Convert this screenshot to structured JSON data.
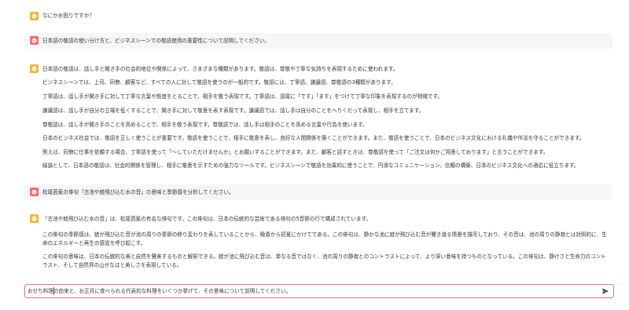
{
  "colors": {
    "assistant_avatar": "#f5b335",
    "user_avatar": "#f06a70",
    "user_bubble_bg": "#f6f6f8",
    "input_border": "#e06f86"
  },
  "icons": {
    "assistant_avatar": "robot-face-icon",
    "user_avatar": "person-face-icon",
    "send": "paper-plane-icon"
  },
  "messages": [
    {
      "role": "assistant",
      "lines": [
        "なにかお困りですか？"
      ]
    },
    {
      "role": "user",
      "lines": [
        "日本語の敬語の使い分け方と、ビジネスシーンでの敬語使用の重要性について説明してください。"
      ]
    },
    {
      "role": "assistant",
      "lines": [
        "日本語の敬語は、話し手と聞き手の社会的地位や関係によって、さまざまな種類があります。敬語は、尊敬や丁寧な気持ちを表現するために使われます。",
        "ビジネスシーンでは、上司、同僚、顧客など、すべての人に対して敬語を使うのが一般的です。敬語には、丁寧語、謙譲語、尊敬語の3種類があります。",
        "丁寧語は、話し手が聞き手に対して丁寧な言葉や態度をとることで、相手を敬う表現です。丁寧語は、語尾に「です」「ます」をつけて丁寧な印象を表現するのが特徴です。",
        "謙譲語は、話し手が自分の立場を低くすることで、聞き手に対して敬意を表す表現です。謙譲語では、話し手は自分のことをへりくだって表現し、相手を立てます。",
        "尊敬語は、話し手が聞き手のことを高めることで、相手を敬う表現です。尊敬語では、話し手は相手のことを高める言葉や行為を使います。",
        "日本のビジネス社会では、敬語を正しく使うことが重要です。敬語を使うことで、相手に敬意を表し、良好な人間関係を築くことができます。また、敬語を使うことで、日本のビジネス文化における礼儀や作法を守ることができます。",
        "例えば、同僚に仕事を依頼する場合、丁寧語を使って「〜していただけませんか」とお願いすることができます。また、顧客と話すときは、尊敬語を使って「ご注文は何かご用意しております」と言うことができます。",
        "結論として、日本語の敬語は、社会的関係を管理し、相手に敬意を示すための強力なツールです。ビジネスシーンで敬語を効果的に使うことで、円滑なコミュニケーション、信頼の構築、日本のビジネス文化への適応に役立ちます。"
      ]
    },
    {
      "role": "user",
      "lines": [
        "松尾芭蕉の俳句『古池や蛙飛び込む水の音』の意味と季節感を分析してください。"
      ]
    },
    {
      "role": "assistant",
      "lines": [
        "「古池や蛙飛び込む水の音」は、松尾芭蕉の有名な俳句です。この俳句は、日本の伝統的な芸術である俳句の5音節の行で構成されています。",
        "この俳句の季節感は、蛙が飛び込む音が池の周りの季節の移り変わりを表していることから、晩春から初夏にかけてである。この俳句は、静かな池に蛙が飛び込む音が響き渡る情景を描写しており、その音は、池の周りの静寂とは対照的に、生命のエネルギーと再生の感覚を呼び起こす。",
        "この俳句の意味は、日本の伝統的な美と自然を賛美するものと解釈できる。蛙が池に飛び込む音は、単なる音ではなく、池の周りの静寂とのコントラストによって、より深い意味を持つものとなっている。この俳句は、静けさと生命力のコントラスト、そして自然界の山がなほと美しさを表現している。"
      ]
    }
  ],
  "input": {
    "value": "おせち料理の由来と、お正月に食べられる代表的な料理をいくつか挙げて、その意味について説明してください。",
    "send_label": "送信"
  }
}
